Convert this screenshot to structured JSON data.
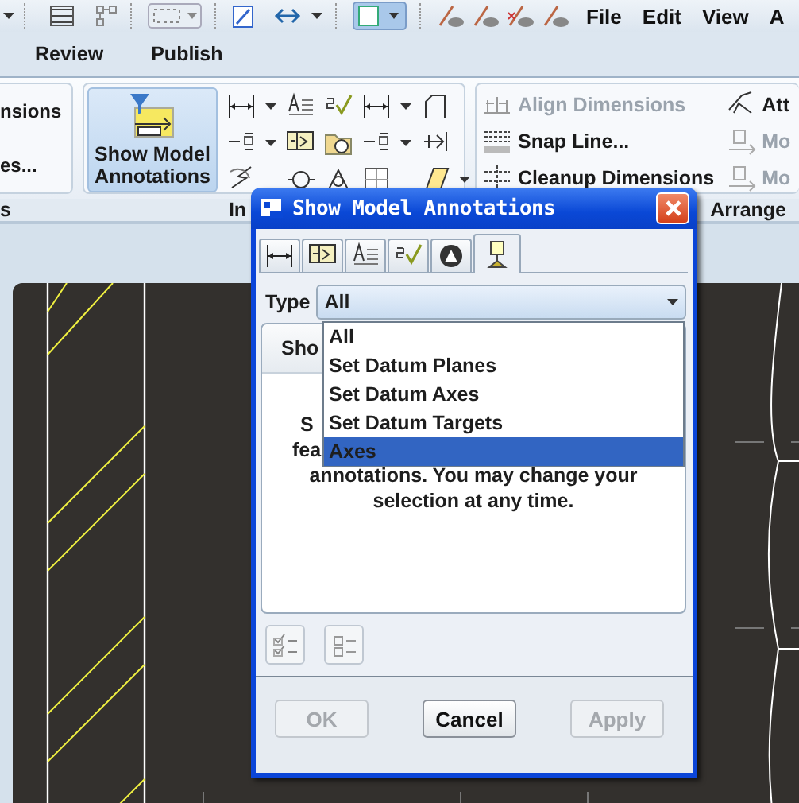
{
  "toolbar": {
    "menus": [
      "File",
      "Edit",
      "View",
      "A"
    ]
  },
  "ribbon": {
    "tabs": [
      "Review",
      "Publish"
    ],
    "left_group": [
      "nsions",
      "es..."
    ],
    "show_model_annotations": {
      "label": "Show Model Annotations",
      "selected": true
    },
    "arrange_group": [
      {
        "label": "Align Dimensions",
        "disabled": true
      },
      {
        "label": "Snap Line...",
        "disabled": false
      },
      {
        "label": "Cleanup Dimensions",
        "disabled": false
      }
    ],
    "right_group": [
      {
        "label": "Att",
        "disabled": false
      },
      {
        "label": "Mo",
        "disabled": true
      },
      {
        "label": "Mo",
        "disabled": true
      }
    ],
    "group_labels": [
      "s",
      "In",
      "Arrange"
    ]
  },
  "dialog": {
    "title": "Show Model Annotations",
    "tabs": [
      {
        "selected": false
      },
      {
        "selected": false
      },
      {
        "selected": false
      },
      {
        "selected": false
      },
      {
        "selected": false
      },
      {
        "selected": true
      }
    ],
    "type_label": "Type",
    "type_value": "All",
    "dropdown": [
      {
        "label": "All",
        "selected": false
      },
      {
        "label": "Set Datum Planes",
        "selected": false
      },
      {
        "label": "Set Datum Axes",
        "selected": false
      },
      {
        "label": "Set Datum Targets",
        "selected": false
      },
      {
        "label": "Axes",
        "selected": true
      }
    ],
    "panel_tab": "Sho",
    "description": [
      "S",
      "fea",
      "annotations. You may change your",
      "selection at any time."
    ],
    "buttons": [
      {
        "label": "OK",
        "disabled": true
      },
      {
        "label": "Cancel",
        "disabled": false
      },
      {
        "label": "Apply",
        "disabled": true
      }
    ]
  }
}
